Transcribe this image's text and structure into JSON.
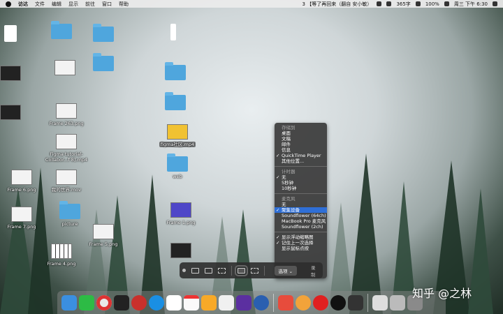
{
  "menubar": {
    "app_name": "访达",
    "items": [
      "文件",
      "编辑",
      "显示",
      "前往",
      "窗口",
      "帮助"
    ],
    "now_playing": "3 【等了再回来（翻自 安小敏）",
    "speed": "365字",
    "battery": "100%",
    "clock": "周三 下午 6:30"
  },
  "desktop_icons": [
    {
      "label": "Frame 6.png"
    },
    {
      "label": "Frame 7.png"
    },
    {
      "label": "Frame 4.png"
    },
    {
      "label": "Frame 5.png"
    },
    {
      "label": "Frame 263.png"
    },
    {
      "label": "Figma tutorial-\nCollabor...f 8].mp4"
    },
    {
      "label": "我的世界.mov"
    },
    {
      "label": "picture"
    },
    {
      "label": "figma社区.mp4"
    },
    {
      "label": "web"
    },
    {
      "label": "Frame 1.png"
    }
  ],
  "capture_menu": {
    "section_save": "存储到",
    "save_items": [
      "桌面",
      "文稿",
      "邮件",
      "信息",
      "QuickTime Player",
      "其他位置..."
    ],
    "save_checked": "QuickTime Player",
    "section_timer": "计时器",
    "timer_items": [
      "无",
      "5秒钟",
      "10秒钟"
    ],
    "timer_checked": "无",
    "section_mic": "麦克风",
    "mic_items": [
      "无",
      "聚集设备",
      "Soundflower (64ch)",
      "MacBook Pro 麦克风",
      "Soundflower (2ch)"
    ],
    "mic_checked": "聚集设备",
    "mic_highlighted": "聚集设备",
    "option_items": [
      "显示浮动缩略图",
      "记住上一次选择",
      "显示鼠标点按"
    ],
    "options_checked": [
      "显示浮动缩略图",
      "记住上一次选择"
    ]
  },
  "toolbar": {
    "options_label": "选项",
    "record_label": "录制"
  },
  "watermark": "知乎 @之林",
  "colors": {
    "menu_highlight": "#2f6fd6",
    "folder": "#4fa6dd"
  }
}
